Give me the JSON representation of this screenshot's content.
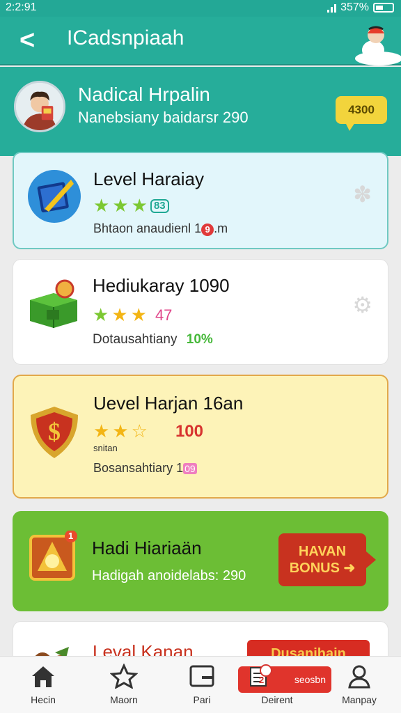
{
  "status": {
    "time": "2:2:91",
    "battery": "357%"
  },
  "appbar": {
    "title": "ICadsnpiaah"
  },
  "profile": {
    "name": "Nadical Hrpalin",
    "subtitle": "Nanebsiany  baidarsr 290",
    "coins": "4300"
  },
  "cards": [
    {
      "title": "Level Haraiay",
      "badge": "83",
      "sub_prefix": "Bhtaon anaudienl 1",
      "sub_mark": "9",
      "sub_suffix": ".m"
    },
    {
      "title": "Hediukaray 1090",
      "stars_value": "47",
      "sub_label": "Dotausahtiany",
      "sub_value": "10%"
    },
    {
      "title": "Uevel Harjan 16an",
      "stars_caption": "snitan",
      "value": "100",
      "sub_prefix": "Bosansahtiary 1",
      "sub_mark": "09"
    },
    {
      "title": "Hadi Hiariaän",
      "sub": "Hadigah anoidelabs: 290",
      "notif": "1",
      "button": "HAVAN BONUS ➜"
    },
    {
      "title": "Leval Kanan",
      "button": "Dusanihain"
    }
  ],
  "nav": [
    {
      "label": "Hecin",
      "icon": "home-icon"
    },
    {
      "label": "Maorn",
      "icon": "star-icon"
    },
    {
      "label": "Pari",
      "icon": "card-icon"
    },
    {
      "label": "Deirent",
      "icon": "document-icon",
      "badge": "2",
      "active_label": "seosbn"
    },
    {
      "label": "Manpay",
      "icon": "user-icon"
    }
  ],
  "colors": {
    "primary": "#26ad9a",
    "gold": "#f2d43c",
    "green_card": "#6cbe35",
    "red": "#c8321f"
  }
}
